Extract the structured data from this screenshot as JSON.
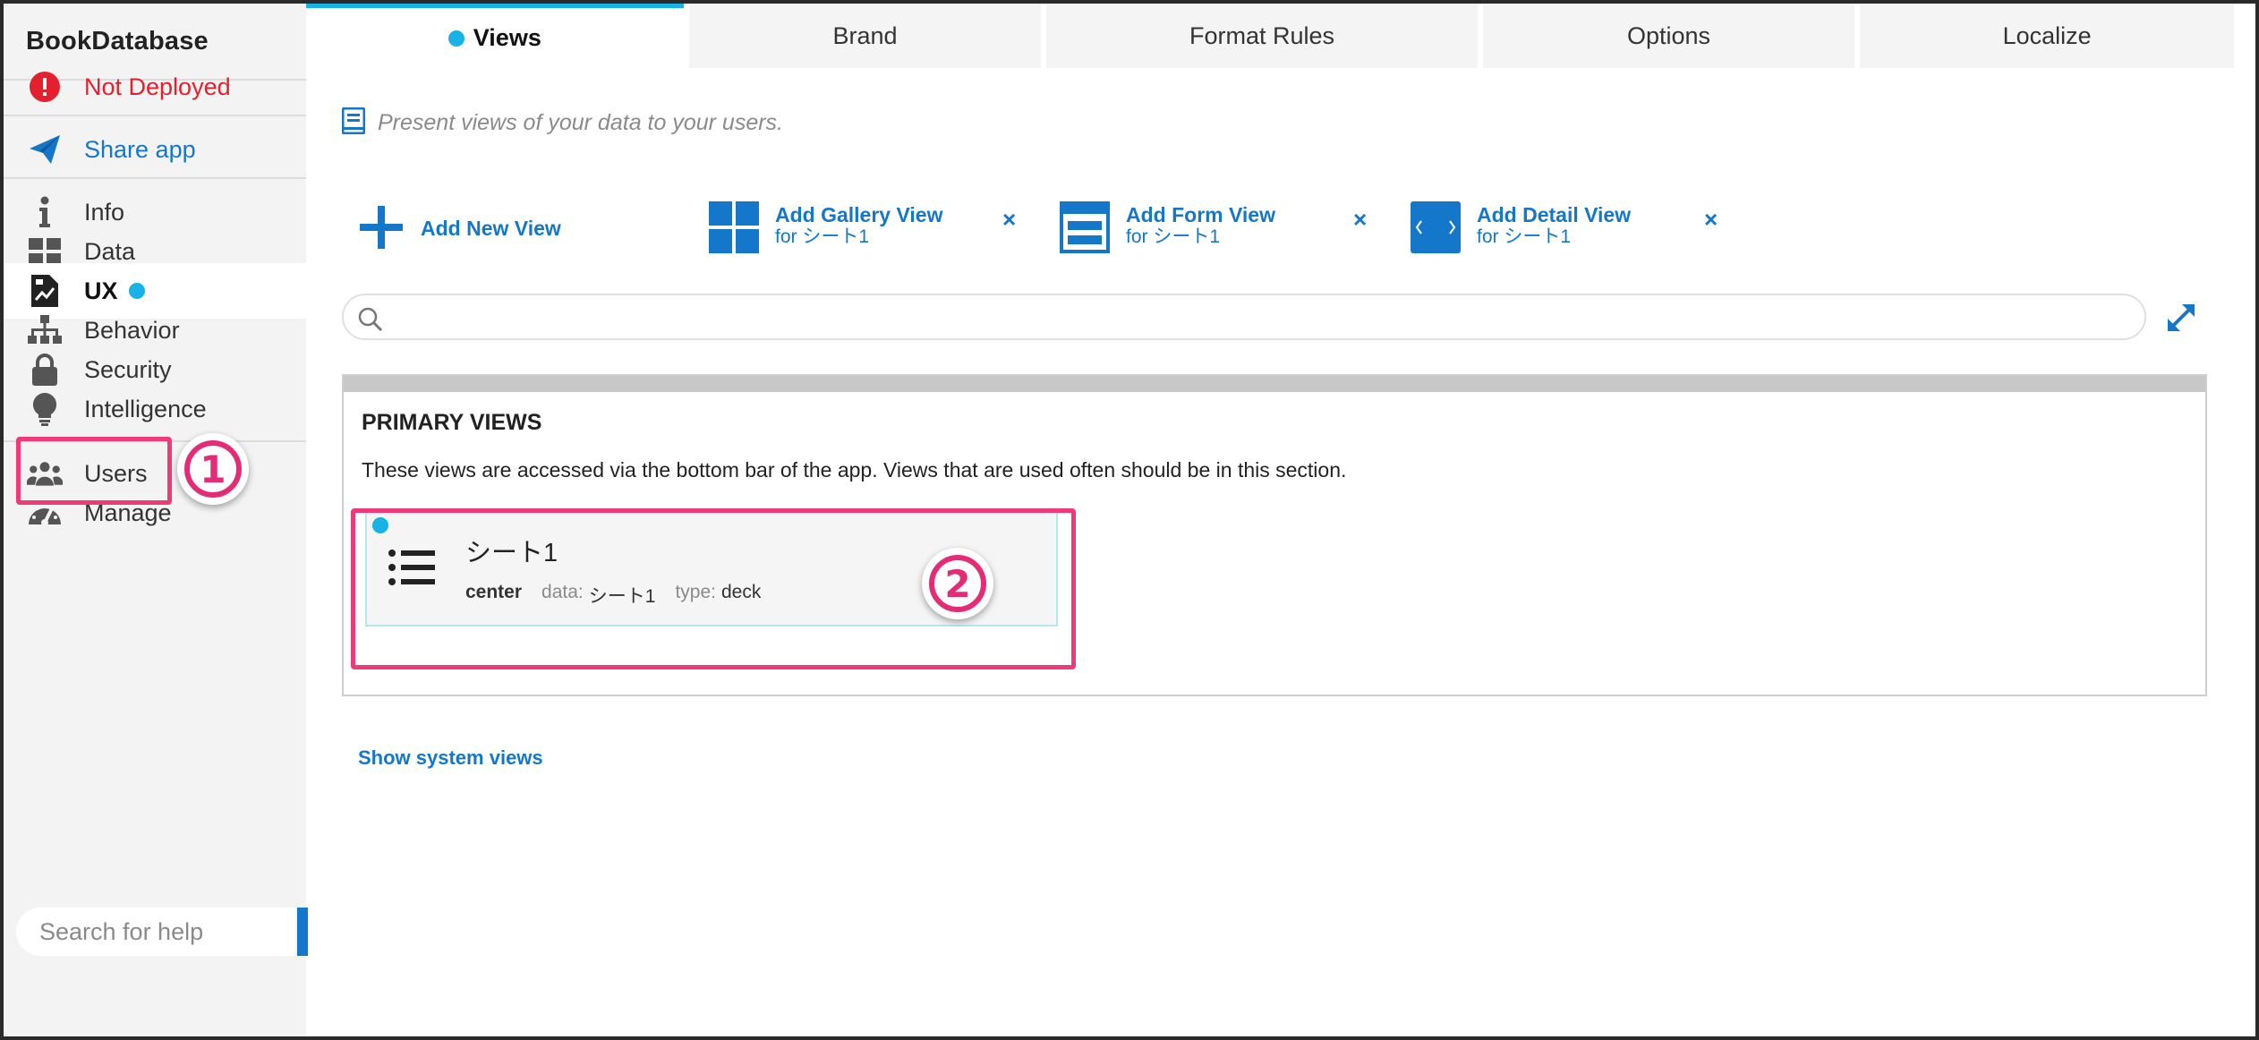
{
  "app": {
    "title": "BookDatabase"
  },
  "sidebar": {
    "status": {
      "label": "Not Deployed"
    },
    "share": {
      "label": "Share app"
    },
    "items": [
      {
        "label": "Info",
        "icon": "info-icon"
      },
      {
        "label": "Data",
        "icon": "data-icon"
      },
      {
        "label": "UX",
        "icon": "ux-icon",
        "active": true
      },
      {
        "label": "Behavior",
        "icon": "behavior-icon"
      },
      {
        "label": "Security",
        "icon": "lock-icon"
      },
      {
        "label": "Intelligence",
        "icon": "lightbulb-icon"
      }
    ],
    "items2": [
      {
        "label": "Users",
        "icon": "users-icon"
      },
      {
        "label": "Manage",
        "icon": "gauge-icon"
      }
    ],
    "search_placeholder": "Search for help"
  },
  "tabs": [
    {
      "label": "Views",
      "active": true
    },
    {
      "label": "Brand"
    },
    {
      "label": "Format Rules"
    },
    {
      "label": "Options"
    },
    {
      "label": "Localize"
    }
  ],
  "main": {
    "description": "Present views of your data to your users.",
    "add_new_view": "Add New View",
    "suggestions": [
      {
        "title": "Add Gallery View",
        "sub": "for シート1",
        "icon": "gallery-icon"
      },
      {
        "title": "Add Form View",
        "sub": "for シート1",
        "icon": "form-icon"
      },
      {
        "title": "Add Detail View",
        "sub": "for シート1",
        "icon": "detail-icon"
      }
    ],
    "close_glyph": "×",
    "search_value": "",
    "primary_views": {
      "title": "PRIMARY VIEWS",
      "description": "These views are accessed via the bottom bar of the app. Views that are used often should be in this section.",
      "views": [
        {
          "name": "シート1",
          "position": "center",
          "data_label": "data:",
          "data_value": "シート1",
          "type_label": "type:",
          "type_value": "deck"
        }
      ]
    },
    "show_system_views": "Show system views"
  },
  "annotations": {
    "one": "1",
    "two": "2"
  },
  "colors": {
    "accent": "#1577c9",
    "dot": "#17b3e6",
    "alert": "#e5202e",
    "annotation": "#ee3a78"
  }
}
